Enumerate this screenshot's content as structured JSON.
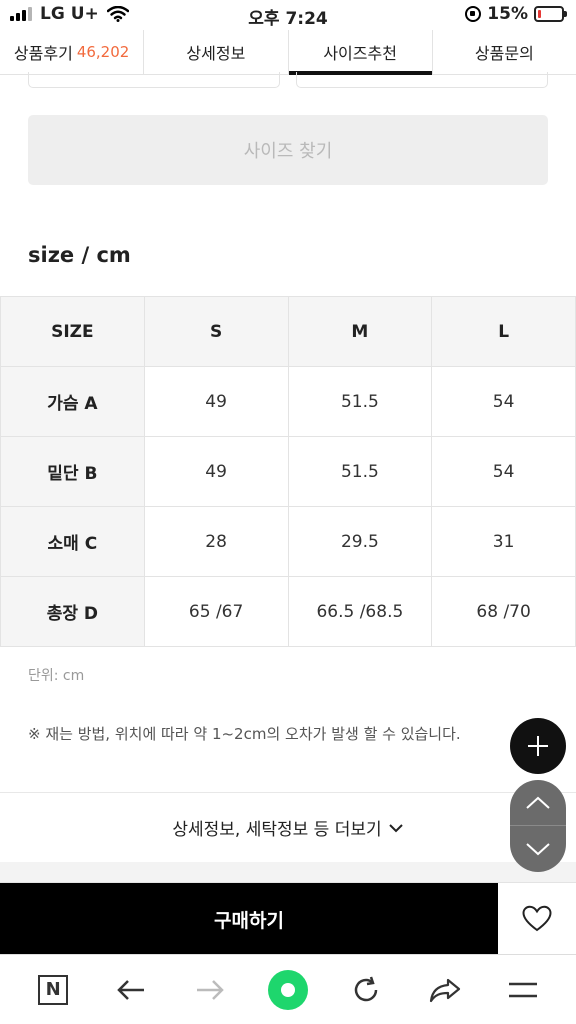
{
  "status_bar": {
    "carrier": "LG U+",
    "time": "오후 7:24",
    "battery_text": "15%",
    "battery_level": 0.15,
    "battery_color": "#e53935"
  },
  "tabs": [
    {
      "label": "상품후기",
      "count": "46,202",
      "active": false
    },
    {
      "label": "상세정보",
      "active": false
    },
    {
      "label": "사이즈추천",
      "active": true
    },
    {
      "label": "상품문의",
      "active": false
    }
  ],
  "size_finder": {
    "button_label": "사이즈 찾기"
  },
  "size_section": {
    "title": "size / cm",
    "headers": [
      "SIZE",
      "S",
      "M",
      "L"
    ],
    "rows": [
      {
        "name": "가슴 A",
        "values": [
          "49",
          "51.5",
          "54"
        ]
      },
      {
        "name": "밑단 B",
        "values": [
          "49",
          "51.5",
          "54"
        ]
      },
      {
        "name": "소매 C",
        "values": [
          "28",
          "29.5",
          "31"
        ]
      },
      {
        "name": "총장 D",
        "values": [
          "65 /67",
          "66.5 /68.5",
          "68 /70"
        ]
      }
    ],
    "unit_text": "단위: cm",
    "note_text": "※ 재는 방법, 위치에 따라 약 1~2cm의 오차가 발생 할 수 있습니다."
  },
  "more_info": {
    "label": "상세정보, 세탁정보 등 더보기",
    "icon": "chevron-down-icon"
  },
  "floating": {
    "plus_icon": "plus-icon",
    "up_icon": "chevron-up-icon",
    "down_icon": "chevron-down-icon"
  },
  "purchase": {
    "buy_label": "구매하기",
    "wish_icon": "heart-icon"
  },
  "browser_bar": {
    "home_label": "N",
    "icons": [
      "naver-home-icon",
      "back-arrow-icon",
      "forward-arrow-icon",
      "green-dot-icon",
      "refresh-icon",
      "share-icon",
      "menu-icon"
    ]
  },
  "colors": {
    "accent_count": "#f26a3d",
    "buy_bg": "#000000",
    "green": "#1ed66d"
  }
}
